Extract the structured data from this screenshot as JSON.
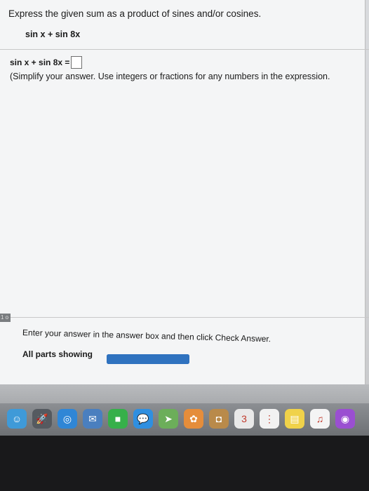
{
  "question": {
    "title": "Express the given sum as a product of sines and/or cosines.",
    "given_expression": "sin x + sin 8x"
  },
  "answer": {
    "lhs": "sin x + sin 8x =",
    "value": "",
    "instruction": "(Simplify your answer. Use integers or fractions for any numbers in the expression."
  },
  "side_tab": {
    "label": "1 o"
  },
  "footer": {
    "enter_text": "Enter your answer in the answer box and then click Check Answer.",
    "parts_label": "All parts showing"
  },
  "progress": {
    "fraction": 1.0
  },
  "dock": {
    "icons": [
      {
        "name": "finder-icon",
        "glyph": "☺",
        "color": "#3f9ad8"
      },
      {
        "name": "launchpad-icon",
        "glyph": "🚀",
        "color": "#555a60"
      },
      {
        "name": "safari-icon",
        "glyph": "◎",
        "color": "#2f86d6"
      },
      {
        "name": "mail-icon",
        "glyph": "✉",
        "color": "#4a7fbf"
      },
      {
        "name": "facetime-icon",
        "glyph": "■",
        "color": "#36b04a"
      },
      {
        "name": "messages-icon",
        "glyph": "💬",
        "color": "#2f8fe0"
      },
      {
        "name": "maps-icon",
        "glyph": "➤",
        "color": "#6cae5a"
      },
      {
        "name": "photos-icon",
        "glyph": "✿",
        "color": "#e58d3b"
      },
      {
        "name": "contacts-icon",
        "glyph": "◘",
        "color": "#b98a4a"
      },
      {
        "name": "calendar-icon",
        "glyph": "3",
        "color": "#e9e9e9"
      },
      {
        "name": "reminders-icon",
        "glyph": "⋮",
        "color": "#f2f2f2"
      },
      {
        "name": "notes-icon",
        "glyph": "▤",
        "color": "#f0d24a"
      },
      {
        "name": "music-icon",
        "glyph": "♫",
        "color": "#f4f4f4"
      },
      {
        "name": "podcasts-icon",
        "glyph": "◉",
        "color": "#9a4fd1"
      }
    ]
  }
}
